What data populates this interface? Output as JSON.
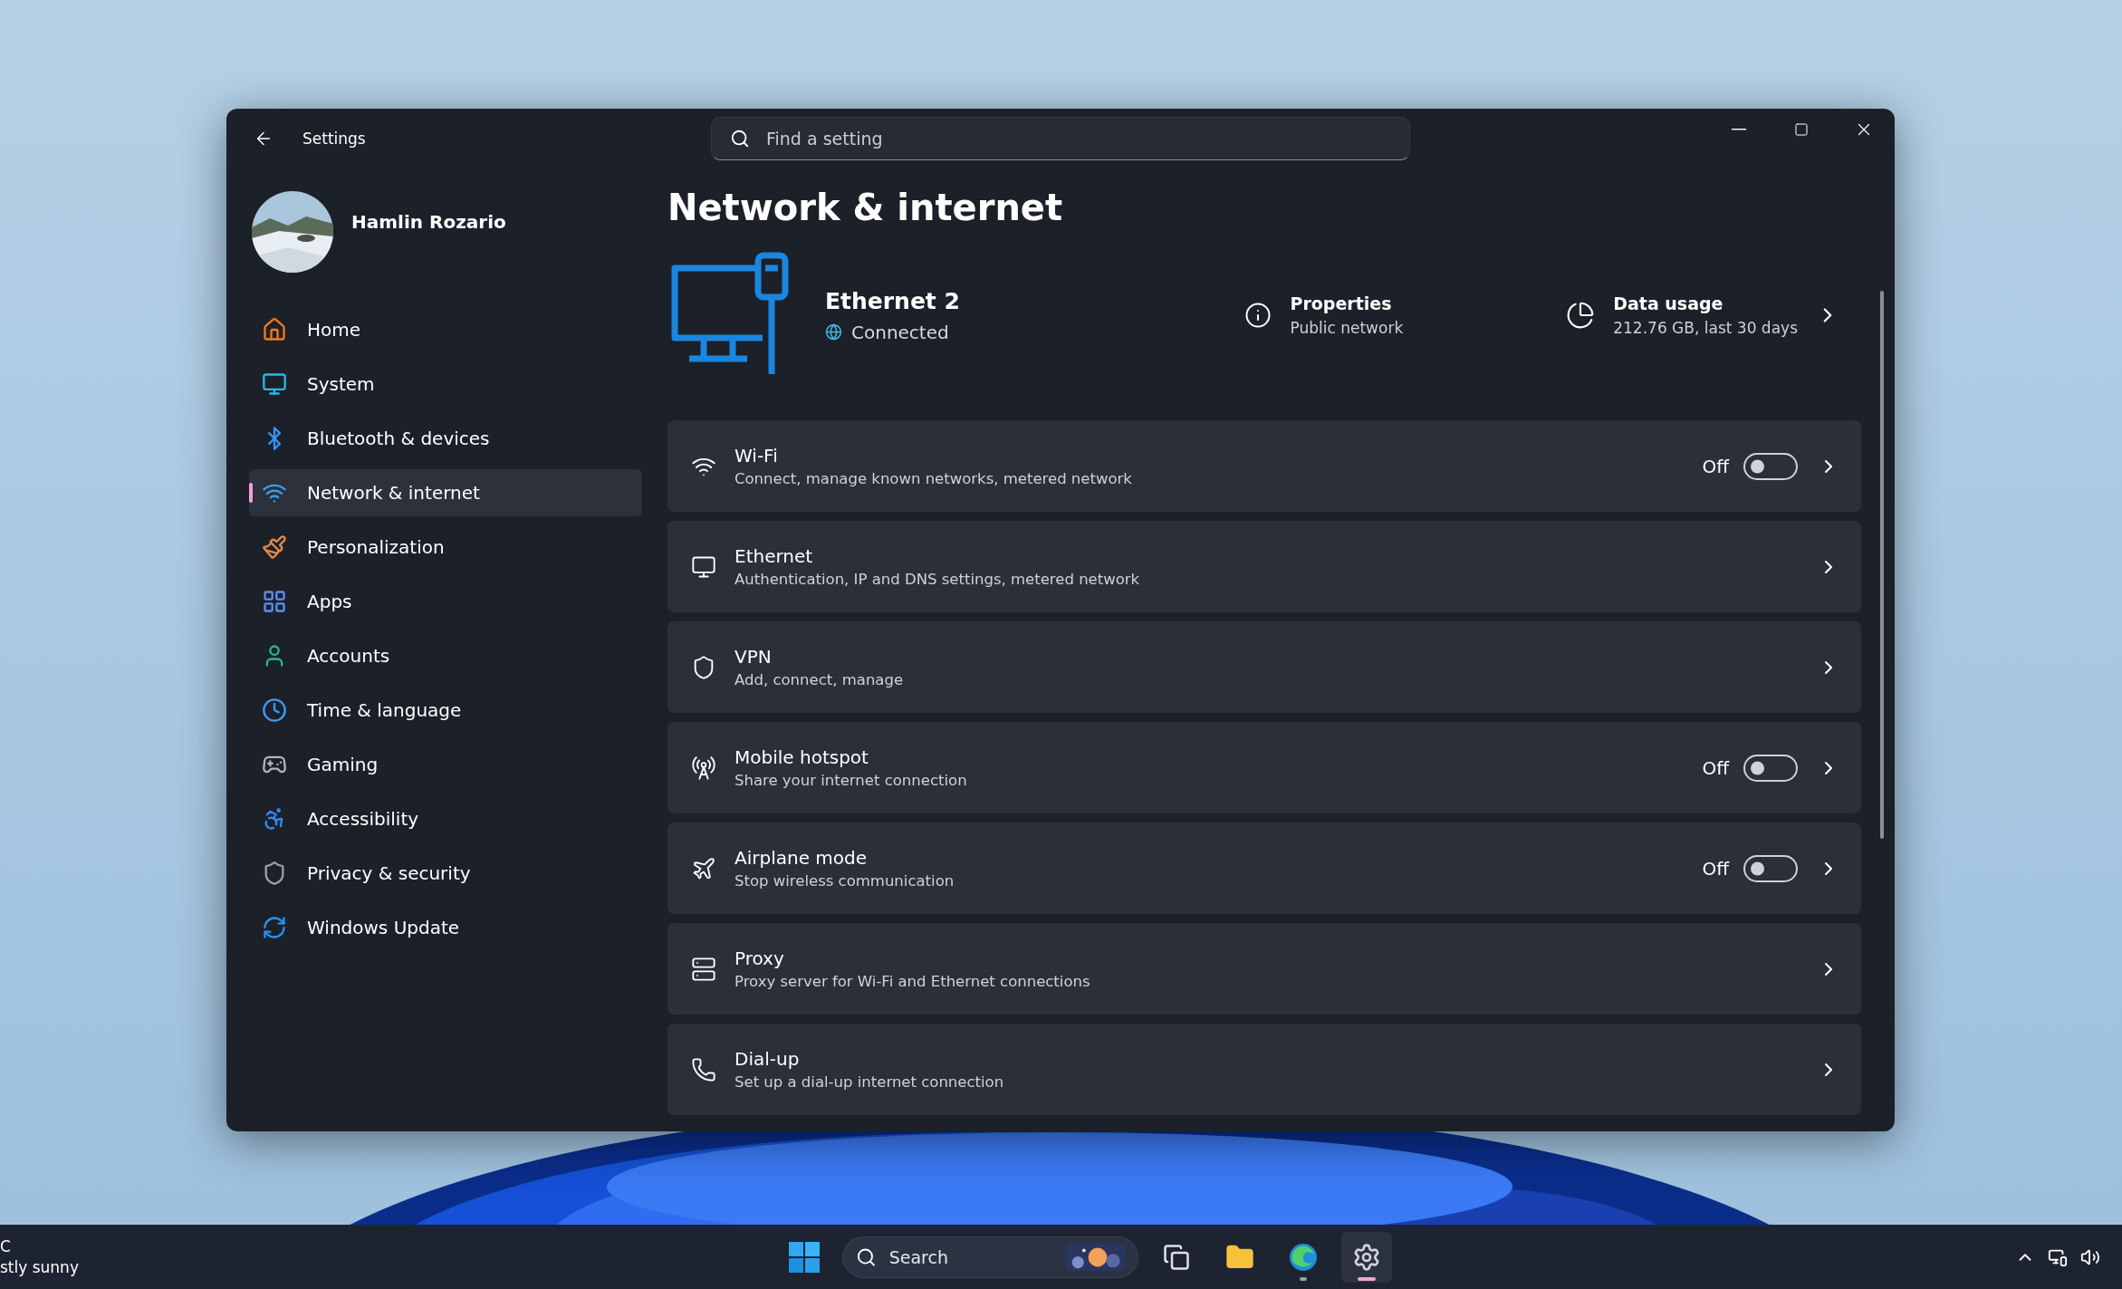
{
  "window": {
    "title": "Settings",
    "search": {
      "placeholder": "Find a setting"
    }
  },
  "user": {
    "name": "Hamlin Rozario"
  },
  "sidebar": {
    "items": [
      {
        "label": "Home",
        "selected": false
      },
      {
        "label": "System",
        "selected": false
      },
      {
        "label": "Bluetooth & devices",
        "selected": false
      },
      {
        "label": "Network & internet",
        "selected": true
      },
      {
        "label": "Personalization",
        "selected": false
      },
      {
        "label": "Apps",
        "selected": false
      },
      {
        "label": "Accounts",
        "selected": false
      },
      {
        "label": "Time & language",
        "selected": false
      },
      {
        "label": "Gaming",
        "selected": false
      },
      {
        "label": "Accessibility",
        "selected": false
      },
      {
        "label": "Privacy & security",
        "selected": false
      },
      {
        "label": "Windows Update",
        "selected": false
      }
    ]
  },
  "page": {
    "title": "Network & internet"
  },
  "connection": {
    "name": "Ethernet 2",
    "status": "Connected",
    "properties": {
      "title": "Properties",
      "subtitle": "Public network"
    },
    "data_usage": {
      "title": "Data usage",
      "subtitle": "212.76 GB, last 30 days"
    }
  },
  "settings": [
    {
      "kind": "toggle",
      "title": "Wi-Fi",
      "description": "Connect, manage known networks, metered network",
      "state_label": "Off",
      "on": false
    },
    {
      "kind": "link",
      "title": "Ethernet",
      "description": "Authentication, IP and DNS settings, metered network"
    },
    {
      "kind": "link",
      "title": "VPN",
      "description": "Add, connect, manage"
    },
    {
      "kind": "toggle",
      "title": "Mobile hotspot",
      "description": "Share your internet connection",
      "state_label": "Off",
      "on": false
    },
    {
      "kind": "toggle",
      "title": "Airplane mode",
      "description": "Stop wireless communication",
      "state_label": "Off",
      "on": false
    },
    {
      "kind": "link",
      "title": "Proxy",
      "description": "Proxy server for Wi-Fi and Ethernet connections"
    },
    {
      "kind": "link",
      "title": "Dial-up",
      "description": "Set up a dial-up internet connection"
    }
  ],
  "taskbar": {
    "weather": {
      "line_1": "C",
      "line_2": "stly sunny"
    },
    "search": {
      "placeholder": "Search"
    },
    "apps": [
      {
        "selected": false,
        "running": false
      },
      {
        "selected": false,
        "running": false
      },
      {
        "selected": false,
        "running": true
      },
      {
        "selected": true,
        "running": true
      }
    ]
  }
}
